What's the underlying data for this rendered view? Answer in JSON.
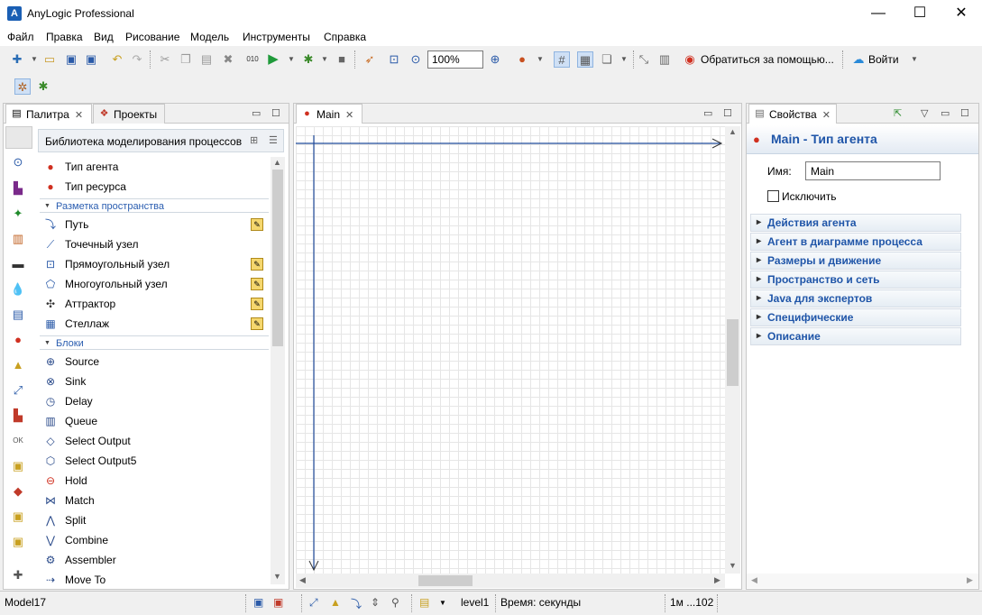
{
  "window": {
    "title": "AnyLogic Professional",
    "logo_char": "A"
  },
  "menu": [
    "Файл",
    "Правка",
    "Вид",
    "Рисование",
    "Модель",
    "Инструменты",
    "Справка"
  ],
  "toolbar": {
    "zoom": "100%",
    "help_label": "Обратиться за помощью...",
    "login_label": "Войти"
  },
  "left_panel": {
    "tabs": [
      {
        "label": "Палитра"
      },
      {
        "label": "Проекты"
      }
    ],
    "library_title": "Библиотека моделирования процессов",
    "items_top": [
      {
        "label": "Тип агента",
        "icon": "agent-icon"
      },
      {
        "label": "Тип ресурса",
        "icon": "resource-icon"
      }
    ],
    "section_space": "Разметка пространства",
    "items_space": [
      {
        "label": "Путь",
        "icon": "path-icon",
        "edit": true
      },
      {
        "label": "Точечный узел",
        "icon": "point-node-icon",
        "edit": false
      },
      {
        "label": "Прямоугольный узел",
        "icon": "rect-node-icon",
        "edit": true
      },
      {
        "label": "Многоугольный узел",
        "icon": "polygon-node-icon",
        "edit": true
      },
      {
        "label": "Аттрактор",
        "icon": "attractor-icon",
        "edit": true
      },
      {
        "label": "Стеллаж",
        "icon": "rack-icon",
        "edit": true
      }
    ],
    "section_blocks": "Блоки",
    "items_blocks": [
      {
        "label": "Source",
        "icon": "source-icon"
      },
      {
        "label": "Sink",
        "icon": "sink-icon"
      },
      {
        "label": "Delay",
        "icon": "delay-icon"
      },
      {
        "label": "Queue",
        "icon": "queue-icon"
      },
      {
        "label": "Select Output",
        "icon": "select-output-icon"
      },
      {
        "label": "Select Output5",
        "icon": "select-output5-icon"
      },
      {
        "label": "Hold",
        "icon": "hold-icon"
      },
      {
        "label": "Match",
        "icon": "match-icon"
      },
      {
        "label": "Split",
        "icon": "split-icon"
      },
      {
        "label": "Combine",
        "icon": "combine-icon"
      },
      {
        "label": "Assembler",
        "icon": "assembler-icon"
      },
      {
        "label": "Move To",
        "icon": "move-to-icon"
      }
    ]
  },
  "editor": {
    "tab": "Main"
  },
  "properties": {
    "tab": "Свойства",
    "header": "Main - Тип агента",
    "name_label": "Имя:",
    "name_value": "Main",
    "exclude_label": "Исключить",
    "sections": [
      "Действия агента",
      "Агент в диаграмме процесса",
      "Размеры и движение",
      "Пространство и сеть",
      "Java для экспертов",
      "Специфические",
      "Описание"
    ]
  },
  "status": {
    "model": "Model17",
    "level": "level1",
    "time": "Время: секунды",
    "scale": "1м ...102"
  }
}
